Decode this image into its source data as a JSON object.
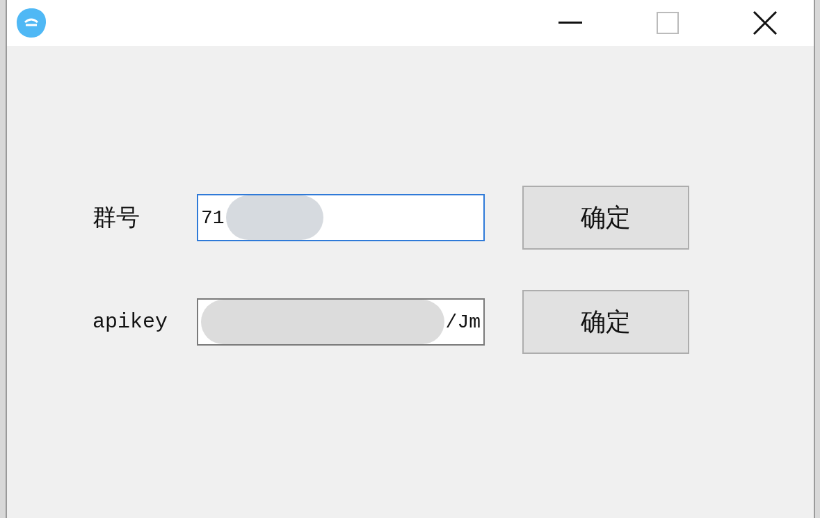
{
  "window": {
    "buttons": [
      {
        "kind": "minimize"
      },
      {
        "kind": "maximize"
      },
      {
        "kind": "close"
      }
    ]
  },
  "rows": [
    {
      "label": "群号",
      "focused": true,
      "parts": [
        {
          "kind": "text",
          "text": "71"
        },
        {
          "kind": "blur"
        }
      ],
      "button": "确定"
    },
    {
      "label": "apikey",
      "focused": false,
      "parts": [
        {
          "kind": "blur"
        },
        {
          "kind": "text",
          "text": "/Jm"
        }
      ],
      "button": "确定"
    }
  ]
}
